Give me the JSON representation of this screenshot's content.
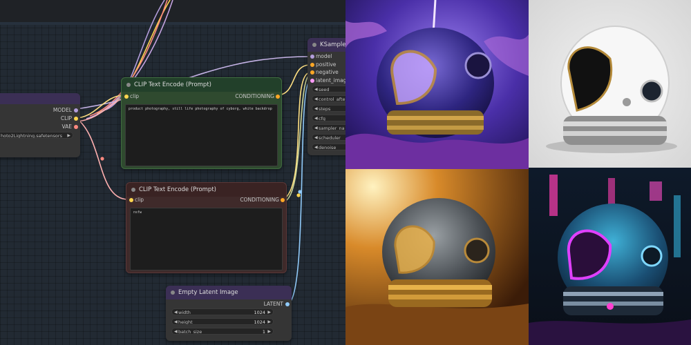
{
  "loader_node": {
    "outputs": [
      "MODEL",
      "CLIP",
      "VAE"
    ],
    "ckpt_name": "hoto2Lightning.safetensors"
  },
  "clip_positive": {
    "title": "CLIP Text Encode (Prompt)",
    "input": "clip",
    "output": "CONDITIONING",
    "text": "product photography, still life photography of cyborg, white backdrop"
  },
  "clip_negative": {
    "title": "CLIP Text Encode (Prompt)",
    "input": "clip",
    "output": "CONDITIONING",
    "text": "nsfw"
  },
  "ksampler": {
    "title": "KSampler",
    "inputs": [
      "model",
      "positive",
      "negative",
      "latent_image"
    ],
    "widgets": [
      "seed",
      "control_afte",
      "steps",
      "cfg",
      "sampler_na",
      "scheduler",
      "denoise"
    ]
  },
  "empty_latent": {
    "title": "Empty Latent Image",
    "output": "LATENT",
    "width_label": "width",
    "width_value": "1024",
    "height_label": "height",
    "height_value": "1024",
    "batch_label": "batch_size",
    "batch_value": "1"
  },
  "colors": {
    "model": "#b39ddb",
    "clip": "#ffd54f",
    "vae": "#ff8a80",
    "conditioning": "#ffa726",
    "latent": "#ff9cf9",
    "image_link": "#64b5f6"
  },
  "outputs_gallery": [
    {
      "name": "purple-nebula-helmet"
    },
    {
      "name": "white-studio-helmet"
    },
    {
      "name": "golden-desert-helmet"
    },
    {
      "name": "neon-cyberpunk-helmet"
    }
  ]
}
